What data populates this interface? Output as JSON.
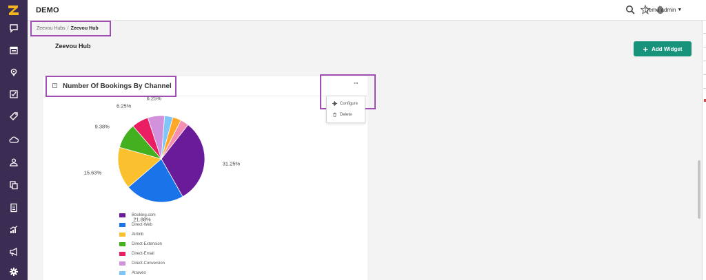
{
  "app": {
    "title": "DEMO",
    "user": "Demo admin"
  },
  "sidebar": {
    "logo": "zeevou-logo",
    "items": [
      {
        "icon": "chat-icon"
      },
      {
        "icon": "calendar-icon"
      },
      {
        "icon": "location-icon"
      },
      {
        "icon": "checklist-icon"
      },
      {
        "icon": "tag-icon"
      },
      {
        "icon": "cloud-icon"
      },
      {
        "icon": "owner-icon"
      },
      {
        "icon": "documents-icon"
      },
      {
        "icon": "invoice-icon"
      },
      {
        "icon": "analytics-icon"
      },
      {
        "icon": "megaphone-icon"
      },
      {
        "icon": "settings-icon"
      }
    ]
  },
  "header": {
    "icons": [
      "search-icon",
      "star-icon",
      "hand-icon"
    ]
  },
  "breadcrumb": {
    "parent": "Zeevou Hubs",
    "separator": "/",
    "current": "Zeevou Hub"
  },
  "page": {
    "title": "Zeevou Hub",
    "add_widget_label": "Add Widget"
  },
  "widget": {
    "title": "Number Of Bookings By Channel",
    "more_label": "···",
    "menu": {
      "configure": "Configure",
      "delete": "Delete"
    }
  },
  "colors": {
    "sidebar": "#3a2c52",
    "accent": "#17927b",
    "highlight": "#a04db4"
  },
  "chart_data": {
    "type": "pie",
    "title": "Number Of Bookings By Channel",
    "slices": [
      {
        "label": "Booking.com",
        "value": 31.25,
        "color": "#6a1b9a",
        "display": "31.25%"
      },
      {
        "label": "Direct-Web",
        "value": 21.88,
        "color": "#1a73e8",
        "display": "21.88%"
      },
      {
        "label": "Airbnb",
        "value": 15.63,
        "color": "#fbc02d",
        "display": "15.63%"
      },
      {
        "label": "Direct-Extension",
        "value": 9.38,
        "color": "#43b020",
        "display": "9.38%"
      },
      {
        "label": "Direct-Email",
        "value": 6.25,
        "color": "#e91e63",
        "display": "6.25%"
      },
      {
        "label": "Direct-Conversion",
        "value": 6.25,
        "color": "#d291dc",
        "display": "6.25%"
      },
      {
        "label": "Atraveo",
        "value": 3.13,
        "color": "#81c4f8",
        "display": ""
      },
      {
        "label": "",
        "value": 3.13,
        "color": "#ffa726",
        "display": ""
      },
      {
        "label": "",
        "value": 3.1,
        "color": "#f48fb1",
        "display": ""
      }
    ],
    "legend_position": "bottom-left"
  }
}
